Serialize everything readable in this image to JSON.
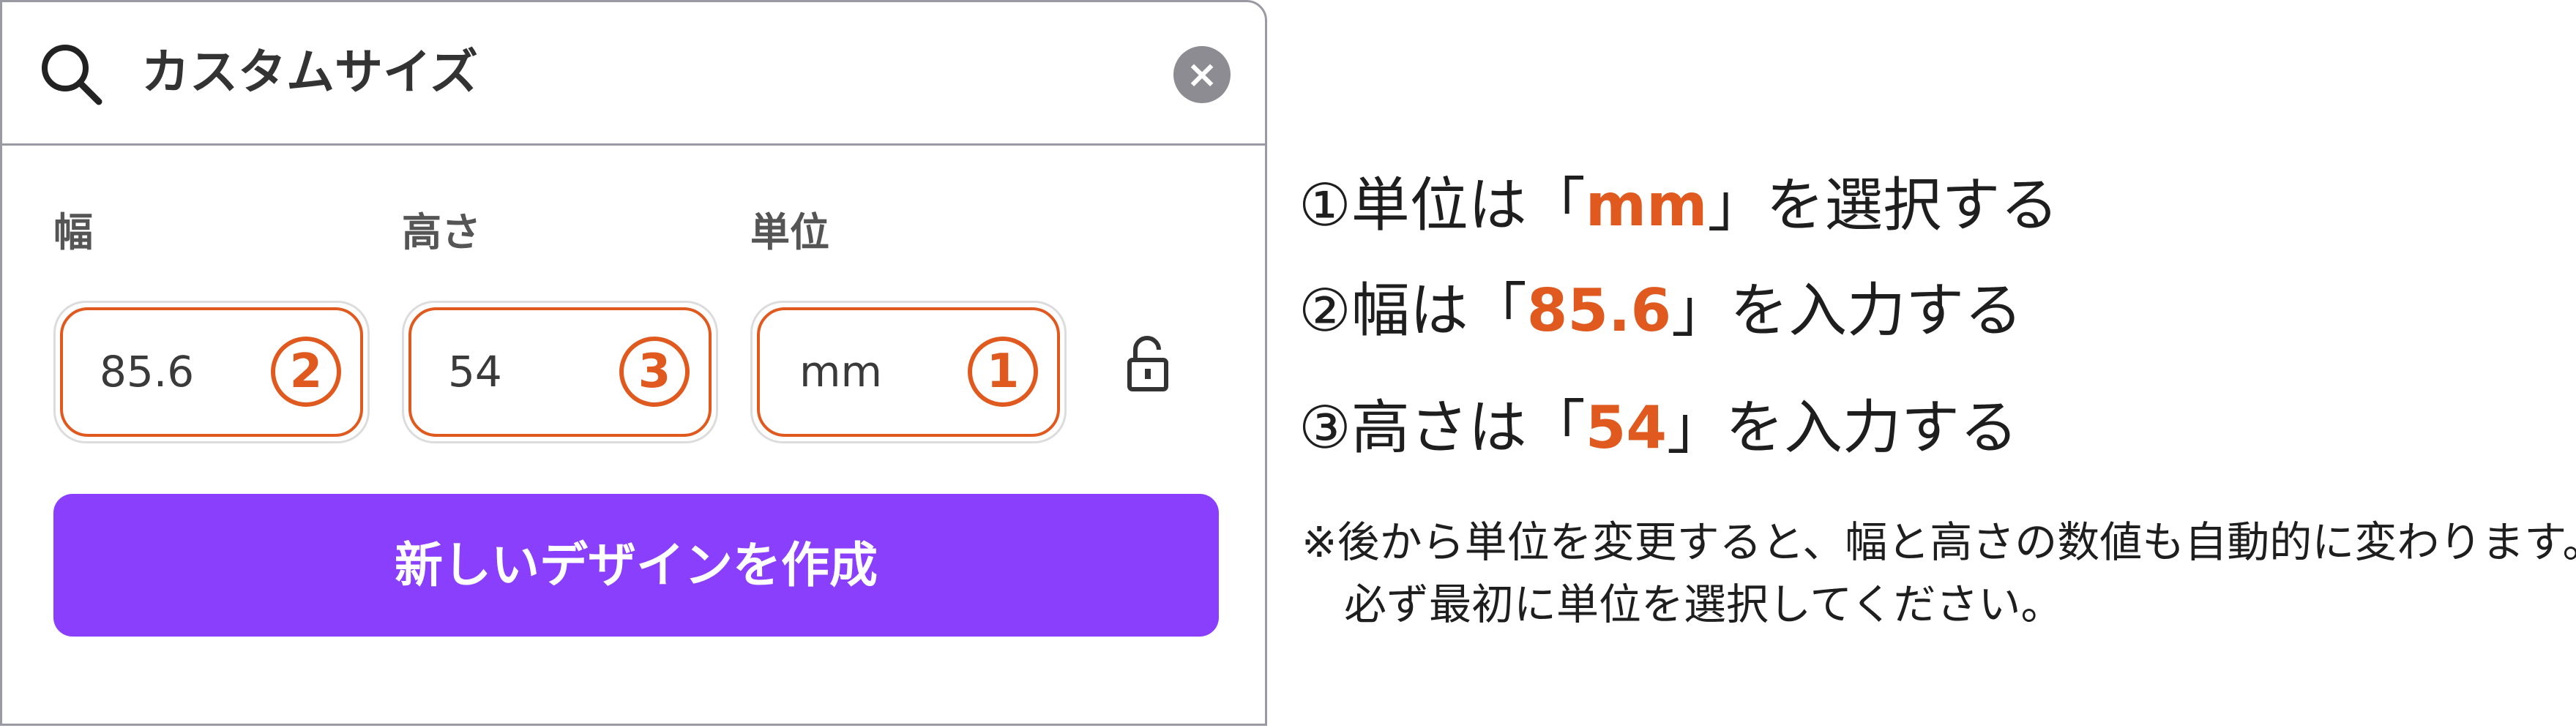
{
  "search": {
    "query": "カスタムサイズ",
    "clear_icon": "close-icon",
    "icon": "search-icon"
  },
  "fields": {
    "width_label": "幅",
    "height_label": "高さ",
    "unit_label": "単位",
    "width_value": "85.6",
    "height_value": "54",
    "unit_value": "mm",
    "width_badge": "2",
    "height_badge": "3",
    "unit_badge": "1",
    "lock_icon": "unlock-icon"
  },
  "create_button": "新しいデザインを作成",
  "instructions": [
    {
      "pre": "①単位は「",
      "value": "mm",
      "post": "」を選択する"
    },
    {
      "pre": "②幅は「",
      "value": "85.6",
      "post": "」を入力する"
    },
    {
      "pre": "③高さは「",
      "value": "54",
      "post": "」を入力する"
    }
  ],
  "notes": [
    "※後から単位を変更すると、幅と高さの数値も自動的に変わります。",
    "　必ず最初に単位を選択してください。"
  ],
  "colors": {
    "accent": "#e05a1f",
    "button": "#8a3ffc",
    "border": "#9a9aa3"
  }
}
